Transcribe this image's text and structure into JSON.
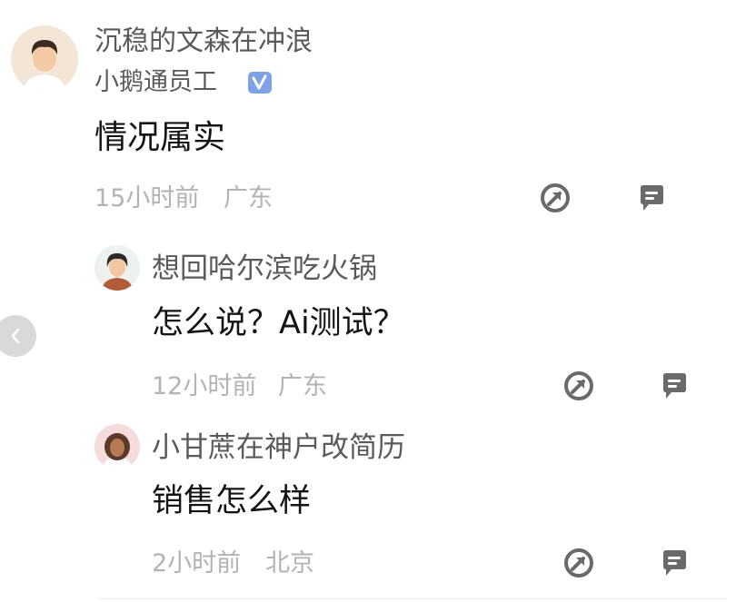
{
  "comments": [
    {
      "username": "沉稳的文森在冲浪",
      "tag": "小鹅通员工",
      "content": "情况属实",
      "time": "15小时前",
      "location": "广东"
    }
  ],
  "replies": [
    {
      "username": "想回哈尔滨吃火锅",
      "content": "怎么说？Ai测试？",
      "time": "12小时前",
      "location": "广东"
    },
    {
      "username": "小甘蔗在神户改简历",
      "content": "销售怎么样",
      "time": "2小时前",
      "location": "北京"
    }
  ],
  "icons": {
    "share": "share-icon",
    "reply": "comment-icon",
    "verified": "verified-badge-icon",
    "prev": "chevron-left-icon"
  },
  "colors": {
    "name": "#5a5a5a",
    "content": "#141414",
    "meta": "#b3b3b3",
    "icon": "#6a6a6a",
    "badge": "#7da3e6"
  }
}
